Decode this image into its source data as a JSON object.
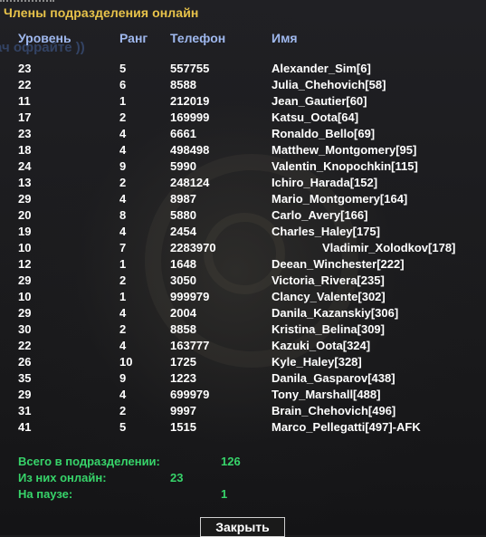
{
  "dialog": {
    "title": "Члены подразделения онлайн",
    "background_hint": "ач офрайте ))",
    "columns": {
      "level": "Уровень",
      "rank": "Ранг",
      "phone": "Телефон",
      "name": "Имя"
    },
    "members": [
      {
        "level": "23",
        "rank": "5",
        "phone": "557755",
        "name": "Alexander_Sim[6]"
      },
      {
        "level": "22",
        "rank": "6",
        "phone": "8588",
        "name": "Julia_Chehovich[58]"
      },
      {
        "level": "11",
        "rank": "1",
        "phone": "212019",
        "name": "Jean_Gautier[60]"
      },
      {
        "level": "17",
        "rank": "2",
        "phone": "169999",
        "name": "Katsu_Oota[64]"
      },
      {
        "level": "23",
        "rank": "4",
        "phone": "6661",
        "name": "Ronaldo_Bello[69]"
      },
      {
        "level": "18",
        "rank": "4",
        "phone": "498498",
        "name": "Matthew_Montgomery[95]"
      },
      {
        "level": "24",
        "rank": "9",
        "phone": "5990",
        "name": "Valentin_Knopochkin[115]"
      },
      {
        "level": "13",
        "rank": "2",
        "phone": "248124",
        "name": "Ichiro_Harada[152]"
      },
      {
        "level": "29",
        "rank": "4",
        "phone": "8987",
        "name": "Mario_Montgomery[164]"
      },
      {
        "level": "20",
        "rank": "8",
        "phone": "5880",
        "name": "Carlo_Avery[166]"
      },
      {
        "level": "19",
        "rank": "4",
        "phone": "2454",
        "name": "Charles_Haley[175]"
      },
      {
        "level": "10",
        "rank": "7",
        "phone": "2283970",
        "name": "Vladimir_Xolodkov[178]"
      },
      {
        "level": "12",
        "rank": "1",
        "phone": "1648",
        "name": "Deean_Winchester[222]"
      },
      {
        "level": "29",
        "rank": "2",
        "phone": "3050",
        "name": "Victoria_Rivera[235]"
      },
      {
        "level": "10",
        "rank": "1",
        "phone": "999979",
        "name": "Clancy_Valente[302]"
      },
      {
        "level": "29",
        "rank": "4",
        "phone": "2004",
        "name": "Danila_Kazanskiy[306]"
      },
      {
        "level": "30",
        "rank": "2",
        "phone": "8858",
        "name": "Kristina_Belina[309]"
      },
      {
        "level": "22",
        "rank": "4",
        "phone": "163777",
        "name": "Kazuki_Oota[324]"
      },
      {
        "level": "26",
        "rank": "10",
        "phone": "1725",
        "name": "Kyle_Haley[328]"
      },
      {
        "level": "35",
        "rank": "9",
        "phone": "1223",
        "name": "Danila_Gasparov[438]"
      },
      {
        "level": "29",
        "rank": "4",
        "phone": "699979",
        "name": "Tony_Marshall[488]"
      },
      {
        "level": "31",
        "rank": "2",
        "phone": "9997",
        "name": "Brain_Chehovich[496]"
      },
      {
        "level": "41",
        "rank": "5",
        "phone": "1515",
        "name": "Marco_Pellegatti[497]-AFK"
      }
    ],
    "summary": {
      "total_label": "Всего в подразделении:",
      "total_value": "126",
      "online_label": "Из них онлайн:",
      "online_value": "23",
      "paused_label": "На паузе:",
      "paused_value": "1"
    },
    "close_label": "Закрыть"
  },
  "colors": {
    "title": "#e8c34a",
    "header": "#9fb8ee",
    "row_text": "#ffffff",
    "summary": "#37d46a"
  }
}
